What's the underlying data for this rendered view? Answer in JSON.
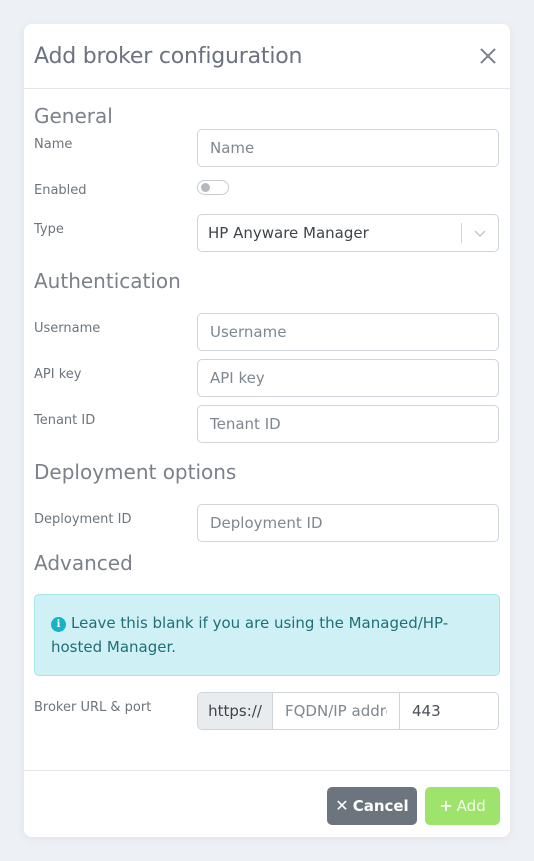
{
  "dialog": {
    "title": "Add broker configuration"
  },
  "sections": {
    "general": "General",
    "authentication": "Authentication",
    "deployment": "Deployment options",
    "advanced": "Advanced"
  },
  "fields": {
    "name": {
      "label": "Name",
      "placeholder": "Name",
      "value": ""
    },
    "enabled": {
      "label": "Enabled",
      "value": false
    },
    "type": {
      "label": "Type",
      "value": "HP Anyware Manager"
    },
    "username": {
      "label": "Username",
      "placeholder": "Username",
      "value": ""
    },
    "api_key": {
      "label": "API key",
      "placeholder": "API key",
      "value": ""
    },
    "tenant_id": {
      "label": "Tenant ID",
      "placeholder": "Tenant ID",
      "value": ""
    },
    "deployment_id": {
      "label": "Deployment ID",
      "placeholder": "Deployment ID",
      "value": ""
    },
    "broker_url": {
      "label": "Broker URL & port",
      "scheme": "https://",
      "host_placeholder": "FQDN/IP address",
      "port_value": "443"
    }
  },
  "alert": {
    "icon": "info-icon",
    "text": "Leave this blank if you are using the Managed/HP-hosted Manager."
  },
  "footer": {
    "cancel_label": "Cancel",
    "add_label": "Add"
  },
  "colors": {
    "cancel_button": "#6c757d",
    "add_button": "#9ee36c",
    "alert_background": "#cff1f5",
    "info_icon": "#16b2c7"
  }
}
